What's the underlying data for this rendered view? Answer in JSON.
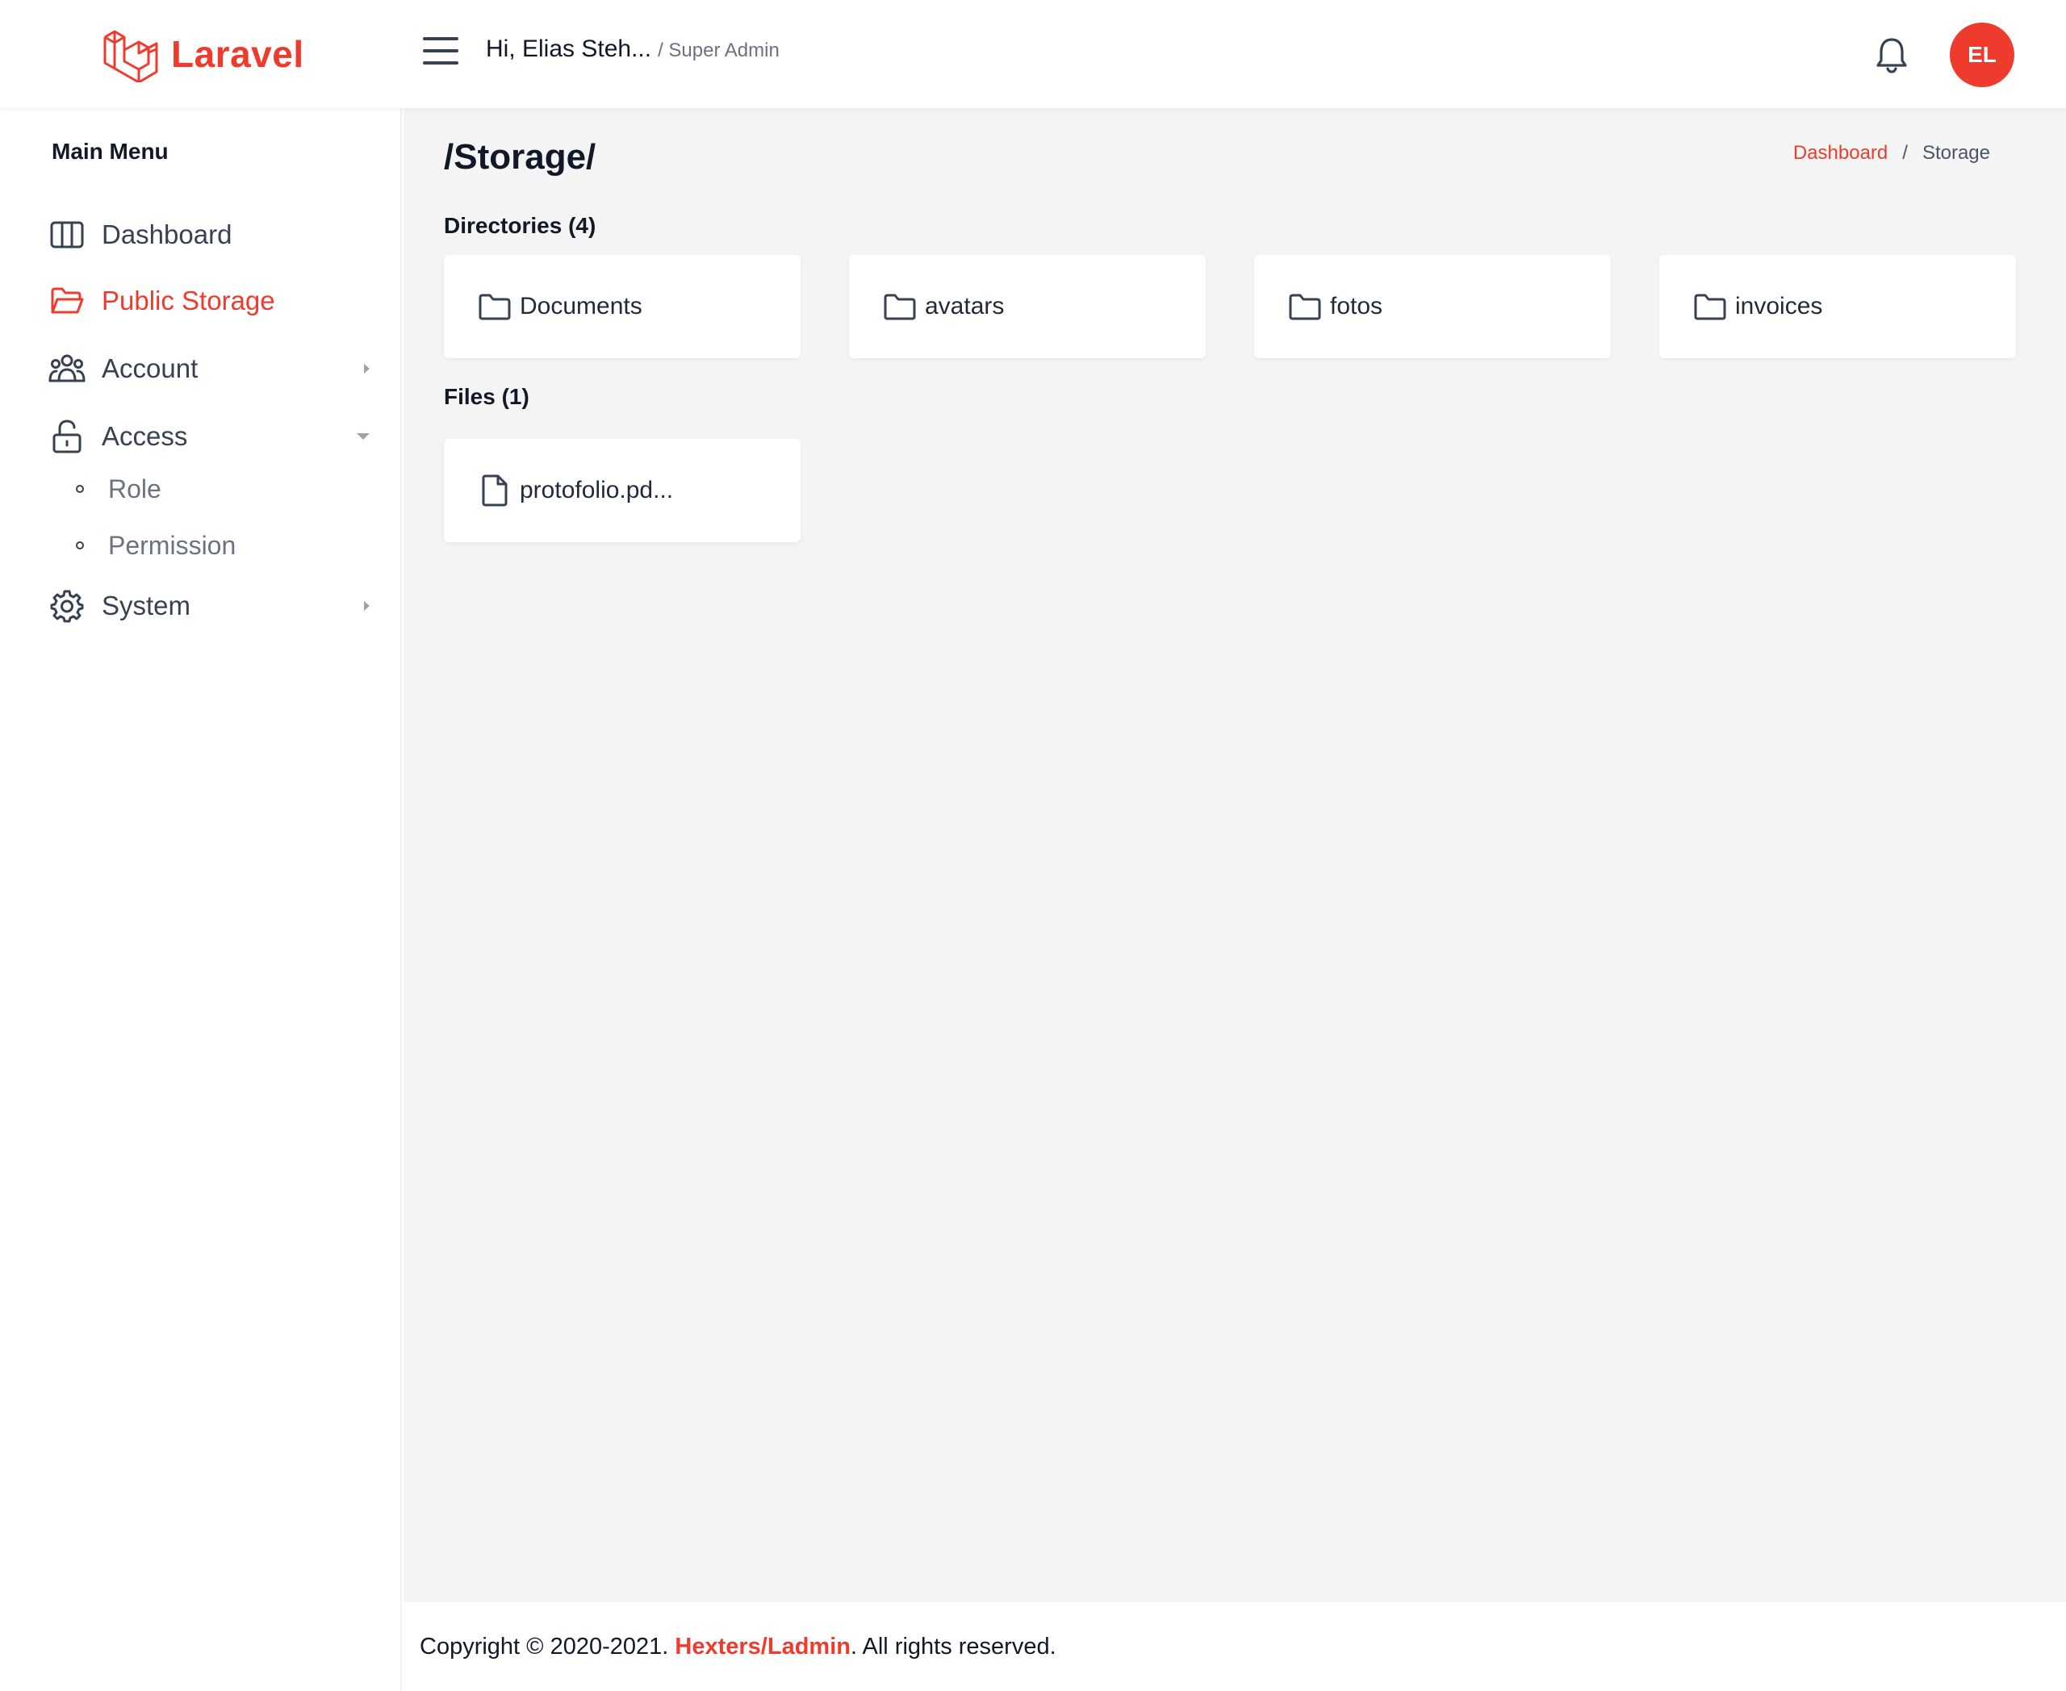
{
  "header": {
    "logo_text": "Laravel",
    "greeting_name": "Hi, Elias Steh...",
    "greeting_role": "/ Super Admin",
    "avatar_initials": "EL"
  },
  "sidebar": {
    "menu_title": "Main Menu",
    "items": [
      {
        "label": "Dashboard",
        "icon": "columns-icon"
      },
      {
        "label": "Public Storage",
        "icon": "folder-open-icon",
        "active": true
      },
      {
        "label": "Account",
        "icon": "users-icon"
      },
      {
        "label": "Access",
        "icon": "lock-open-icon",
        "expanded": true
      },
      {
        "label": "System",
        "icon": "gear-icon"
      }
    ],
    "access_sub": [
      "Role",
      "Permission"
    ]
  },
  "main": {
    "page_title": "/Storage/",
    "breadcrumb": {
      "home": "Dashboard",
      "separator": "/",
      "current": "Storage"
    },
    "directories_title": "Directories (4)",
    "directories": [
      "Documents",
      "avatars",
      "fotos",
      "invoices"
    ],
    "files_title": "Files (1)",
    "files": [
      "protofolio.pd..."
    ]
  },
  "footer": {
    "prefix": "Copyright © 2020-2021.",
    "brand": "Hexters/Ladmin",
    "suffix": ". All rights reserved."
  },
  "colors": {
    "accent": "#ef3b2d",
    "background": "#f4f4f4",
    "text": "#1f2937"
  }
}
